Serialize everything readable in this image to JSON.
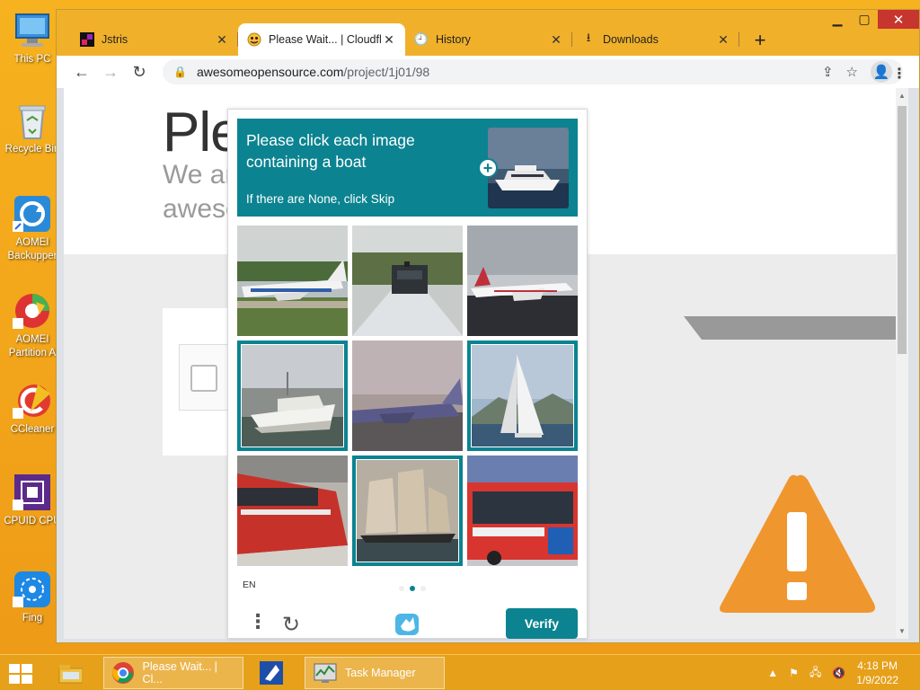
{
  "desktop": {
    "icons": [
      {
        "label": "This PC",
        "icon": "computer-icon"
      },
      {
        "label": "Recycle Bin",
        "icon": "recycle-bin-icon"
      },
      {
        "label": "AOMEI Backupper",
        "icon": "aomei-backupper-icon"
      },
      {
        "label": "AOMEI Partition A",
        "icon": "aomei-partition-icon"
      },
      {
        "label": "CCleaner",
        "icon": "ccleaner-icon"
      },
      {
        "label": "CPUID CPU",
        "icon": "cpuid-icon"
      },
      {
        "label": "Fing",
        "icon": "fing-icon"
      }
    ]
  },
  "browser": {
    "tabs": [
      {
        "title": "Jstris",
        "icon": "jstris-icon",
        "active": false
      },
      {
        "title": "Please Wait... | Cloudflare",
        "icon": "cloudflare-face-icon",
        "active": true
      },
      {
        "title": "History",
        "icon": "history-icon",
        "active": false
      },
      {
        "title": "Downloads",
        "icon": "download-icon",
        "active": false
      }
    ],
    "url_host": "awesomeopensource.com",
    "url_path": "/project/1j01/98"
  },
  "page": {
    "title": "Ple",
    "sub1": "We ar",
    "sub2": "awesc"
  },
  "captcha": {
    "prompt": "Please click each image containing a boat",
    "hint": "If there are None, click Skip",
    "language": "EN",
    "verify_label": "Verify",
    "accent": "#0b8390",
    "tiles": [
      {
        "subject": "airplane",
        "selected": false
      },
      {
        "subject": "train",
        "selected": false
      },
      {
        "subject": "airplane",
        "selected": false
      },
      {
        "subject": "boat",
        "selected": true
      },
      {
        "subject": "airplane",
        "selected": false
      },
      {
        "subject": "sailboat",
        "selected": true
      },
      {
        "subject": "train",
        "selected": false
      },
      {
        "subject": "sailing-ship",
        "selected": true
      },
      {
        "subject": "bus",
        "selected": false
      }
    ]
  },
  "taskbar": {
    "items": [
      {
        "label": "Please Wait... | Cl...",
        "icon": "chrome-icon"
      },
      {
        "label": "Task Manager",
        "icon": "task-manager-icon"
      }
    ],
    "time": "4:18 PM",
    "date": "1/9/2022"
  }
}
